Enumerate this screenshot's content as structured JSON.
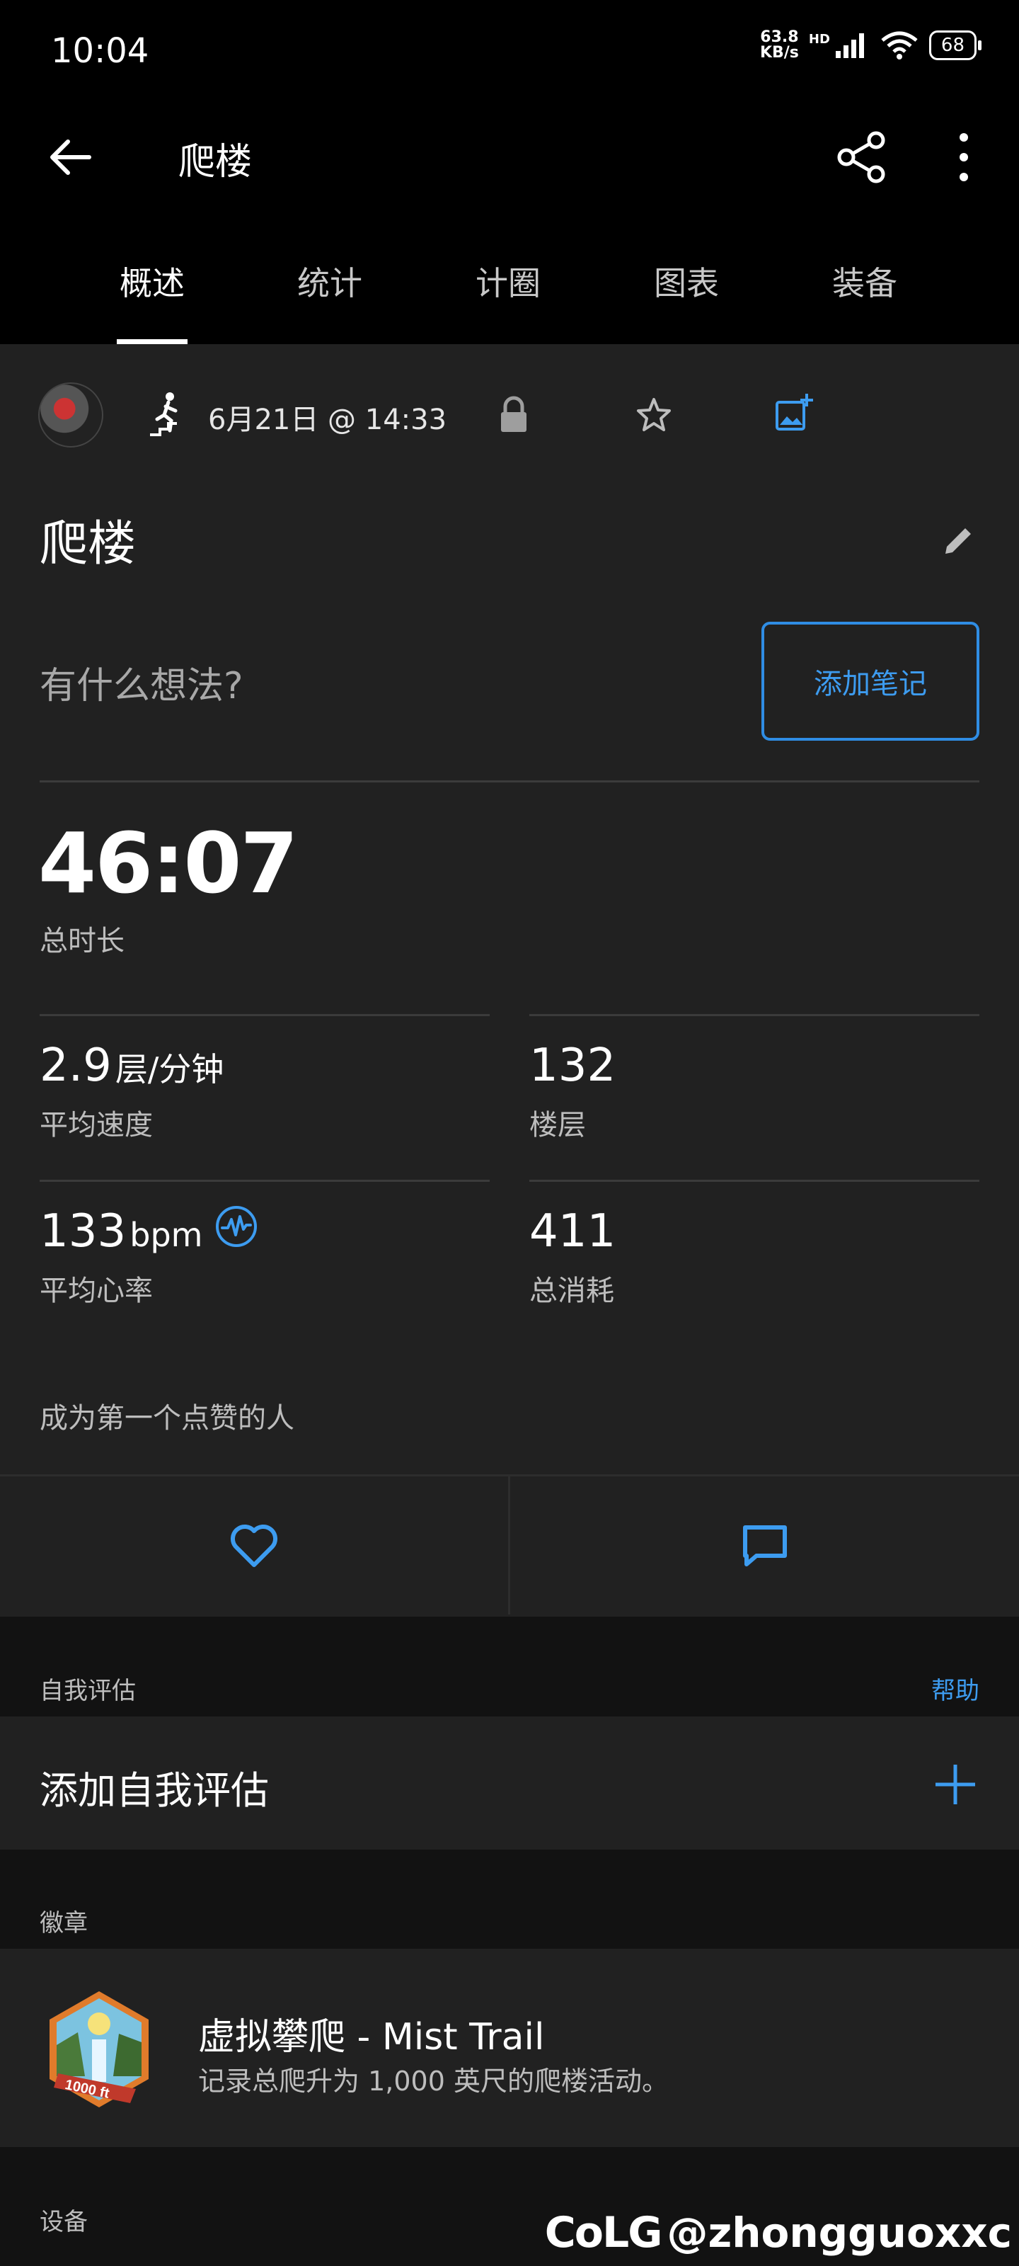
{
  "status_bar": {
    "time": "10:04",
    "net_speed_value": "63.8",
    "net_speed_unit": "KB/s",
    "network_type": "HD",
    "battery": "68"
  },
  "app_bar": {
    "title": "爬楼",
    "back_icon": "arrow-left-icon",
    "share_icon": "share-icon",
    "more_icon": "more-vertical-icon"
  },
  "tabs": [
    {
      "label": "概述",
      "active": true
    },
    {
      "label": "统计",
      "active": false
    },
    {
      "label": "计圈",
      "active": false
    },
    {
      "label": "图表",
      "active": false
    },
    {
      "label": "装备",
      "active": false
    }
  ],
  "activity": {
    "date": "6月21日 @ 14:33",
    "name": "爬楼",
    "note_placeholder": "有什么想法?",
    "add_note_label": "添加笔记"
  },
  "summary": {
    "duration_value": "46:07",
    "duration_label": "总时长"
  },
  "stats": [
    {
      "value": "2.9",
      "unit": "层/分钟",
      "label": "平均速度"
    },
    {
      "value": "132",
      "unit": "",
      "label": "楼层"
    },
    {
      "value": "133",
      "unit": "bpm",
      "label": "平均心率"
    },
    {
      "value": "411",
      "unit": "",
      "label": "总消耗"
    }
  ],
  "kudos_text": "成为第一个点赞的人",
  "self_eval": {
    "section_label": "自我评估",
    "help_label": "帮助",
    "add_label": "添加自我评估"
  },
  "badges": {
    "section_label": "徽章",
    "items": [
      {
        "title": "虚拟攀爬 - Mist Trail",
        "description": "记录总爬升为 1,000 英尺的爬楼活动。",
        "badge_text": "1000 ft"
      }
    ]
  },
  "devices": {
    "section_label": "设备"
  },
  "watermark": {
    "logo": "CoLG",
    "handle": "@zhongguoxxc"
  },
  "colors": {
    "accent": "#3d9cf0",
    "background": "#212121",
    "section_bg": "#121212"
  }
}
